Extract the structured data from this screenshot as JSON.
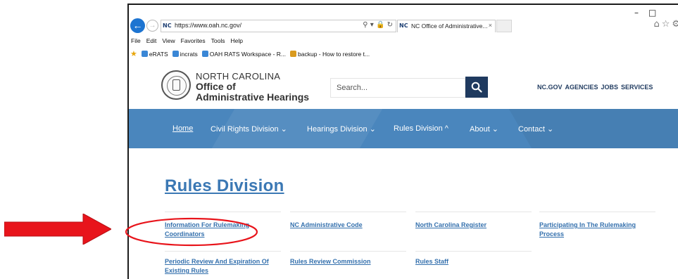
{
  "window": {
    "minimize_glyph": "–",
    "maximize_glyph": "□"
  },
  "browser": {
    "address_favicon": "NC",
    "url": "https://www.oah.nc.gov/",
    "address_tools": "⚲ ▾ 🔒 ↻",
    "tab_favicon": "NC",
    "tab_title": "NC Office of Administrative...",
    "tab_close": "×",
    "toolbar_icons": "⌂☆⚙",
    "menu": [
      "File",
      "Edit",
      "View",
      "Favorites",
      "Tools",
      "Help"
    ],
    "favorites": [
      {
        "label": "eRATS",
        "icon": "ie-page-icon"
      },
      {
        "label": "incrats",
        "icon": "ie-page-icon"
      },
      {
        "label": "OAH RATS Workspace - R...",
        "icon": "ie-page-icon"
      },
      {
        "label": "backup - How to restore t...",
        "icon": "pdf-icon"
      }
    ]
  },
  "site": {
    "org_top": "NORTH CAROLINA",
    "org_line1": "Office of",
    "org_line2": "Administrative Hearings",
    "search_placeholder": "Search...",
    "utility_links": [
      "NC.GOV",
      "AGENCIES",
      "JOBS",
      "SERVICES"
    ],
    "nav": [
      {
        "label": "Home"
      },
      {
        "label": "Civil Rights Division ⌄"
      },
      {
        "label": "Hearings Division ⌄"
      },
      {
        "label": "Rules Division ^"
      },
      {
        "label": "About ⌄"
      },
      {
        "label": "Contact ⌄"
      }
    ]
  },
  "content": {
    "heading": "Rules Division",
    "links": [
      {
        "line1": "Information For Rulemaking",
        "line2": "Coordinators"
      },
      {
        "line1": "NC Administrative Code",
        "line2": ""
      },
      {
        "line1": "North Carolina Register",
        "line2": ""
      },
      {
        "line1": "Participating In The Rulemaking",
        "line2": "Process"
      },
      {
        "line1": "Periodic Review And Expiration Of",
        "line2": "Existing Rules"
      },
      {
        "line1": "Rules Review Commission",
        "line2": ""
      },
      {
        "line1": "Rules Staff",
        "line2": ""
      }
    ]
  },
  "annotations": {
    "arrow_color": "#e8141b",
    "circle_color": "#e8141b"
  },
  "colors": {
    "nav_band": "#4a86bd",
    "link": "#3470ad",
    "heading": "#3b78b4",
    "search_button": "#1f3a5f"
  }
}
